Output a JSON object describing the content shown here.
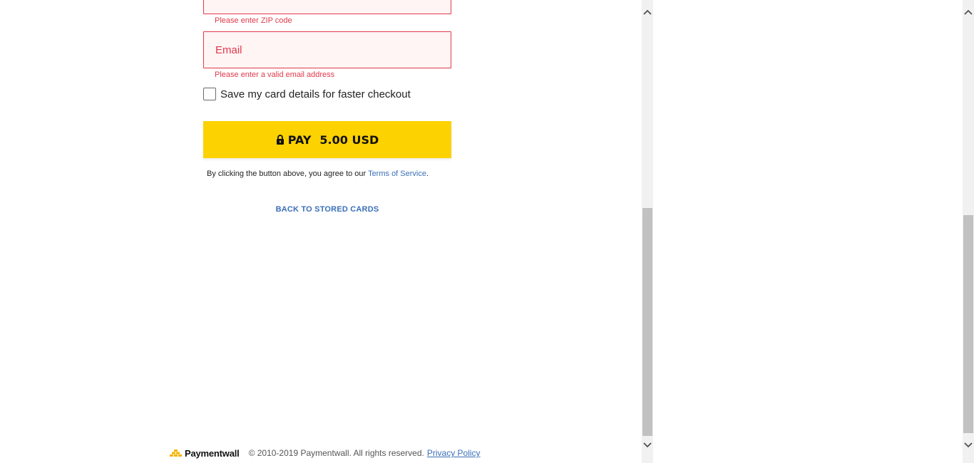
{
  "form": {
    "zip_error": "Please enter ZIP code",
    "email_placeholder": "Email",
    "email_error": "Please enter a valid email address",
    "save_card_label": "Save my card details for faster checkout",
    "pay_button": {
      "label": "PAY",
      "amount": "5.00 USD",
      "color": "#fcd200"
    },
    "terms_prefix": "By clicking the button above, you agree to our ",
    "terms_link": "Terms of Service",
    "terms_suffix": ".",
    "back_link": "BACK TO STORED CARDS"
  },
  "footer": {
    "brand": "Paymentwall",
    "copyright": "© 2010-2019 Paymentwall. All rights reserved.",
    "privacy_link": "Privacy Policy"
  },
  "colors": {
    "error": "#e0394a",
    "link": "#3a6fb8"
  },
  "icons": {
    "pay_button": "lock-icon",
    "scroll_up": "chevron-up-icon",
    "scroll_down": "chevron-down-icon"
  }
}
